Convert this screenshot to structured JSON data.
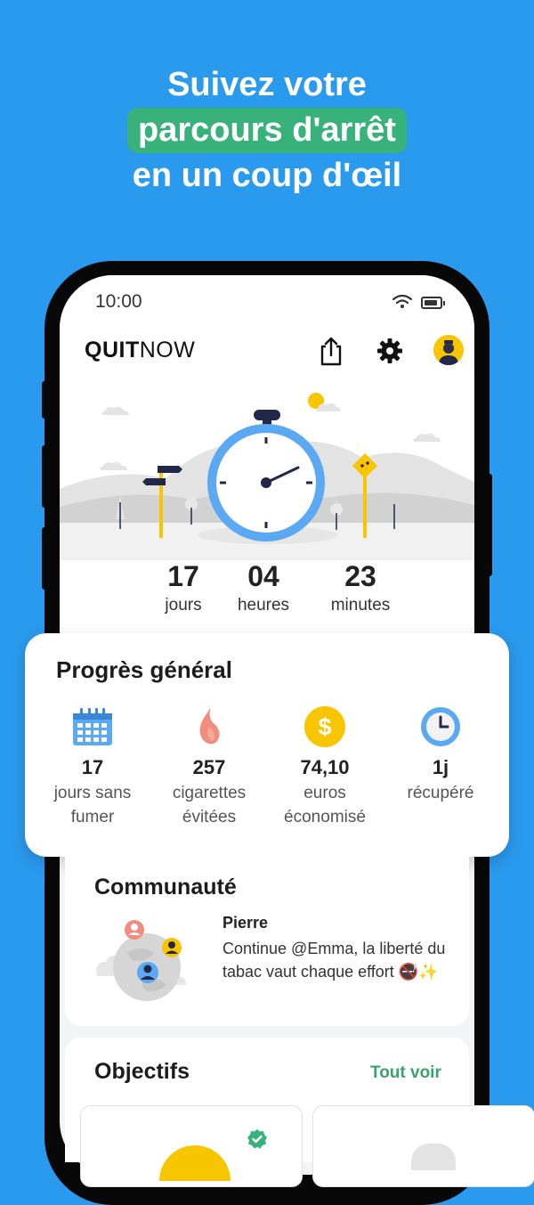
{
  "headline": {
    "line1": "Suivez votre",
    "highlight": "parcours d'arrêt",
    "line3": "en un coup d'œil"
  },
  "status_bar": {
    "time": "10:00"
  },
  "app": {
    "logo_bold": "QUIT",
    "logo_light": "NOW"
  },
  "timer": {
    "days": {
      "value": "17",
      "label": "jours"
    },
    "hours": {
      "value": "04",
      "label": "heures"
    },
    "minutes": {
      "value": "23",
      "label": "minutes"
    }
  },
  "progress": {
    "title": "Progrès général",
    "stats": [
      {
        "icon": "calendar-icon",
        "value": "17",
        "label_line1": "jours sans",
        "label_line2": "fumer"
      },
      {
        "icon": "flame-icon",
        "value": "257",
        "label_line1": "cigarettes",
        "label_line2": "évitées"
      },
      {
        "icon": "dollar-coin-icon",
        "value": "74,10",
        "label_line1": "euros",
        "label_line2": "économisé"
      },
      {
        "icon": "clock-icon",
        "value": "1j",
        "label_line1": "récupéré",
        "label_line2": ""
      }
    ]
  },
  "community": {
    "title": "Communauté",
    "author": "Pierre",
    "message": "Continue @Emma, la liberté du tabac vaut chaque effort 🚭✨"
  },
  "goals": {
    "title": "Objectifs",
    "see_all": "Tout voir"
  },
  "colors": {
    "background": "#2a9aee",
    "highlight": "#38b27a",
    "accent_green": "#38a36d",
    "timer_ring": "#5ba9f2",
    "coin": "#f7c600",
    "flame": "#f08d7e"
  }
}
